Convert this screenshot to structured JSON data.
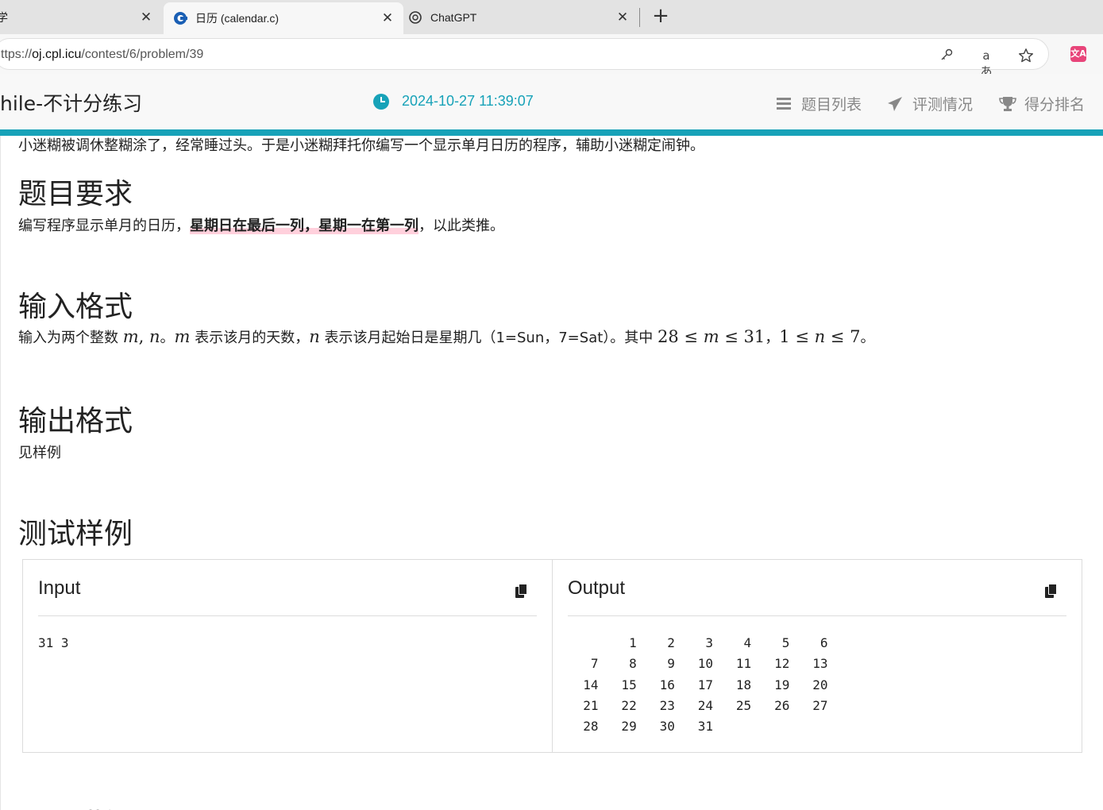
{
  "browser": {
    "tabs": [
      {
        "title": "学",
        "active": false
      },
      {
        "title": "日历 (calendar.c)",
        "active": true
      },
      {
        "title": "ChatGPT",
        "active": false
      }
    ],
    "close_glyph": "✕",
    "new_tab_glyph": "+",
    "url_prefix": "ttps://",
    "url_host": "oj.cpl.icu",
    "url_path": "/contest/6/problem/39",
    "icons": [
      "key-icon",
      "read-aloud-icon",
      "favorite-star-icon",
      "translate-extension-icon"
    ]
  },
  "navbar": {
    "brand": "hile-不计分练习",
    "clock": "2024-10-27 11:39:07",
    "items": [
      "题目列表",
      "评测情况",
      "得分排名"
    ],
    "accent": "#17a2b8"
  },
  "problem": {
    "intro": "小迷糊被调休整糊涂了，经常睡过头。于是小迷糊拜托你编写一个显示单月日历的程序，辅助小迷糊定闹钟。",
    "req_title": "题目要求",
    "req_pre": "编写程序显示单月的日历，",
    "req_bold": "星期日在最后一列，星期一在第一列",
    "req_post": "，以此类推。",
    "input_title": "输入格式",
    "input_p1": "输入为两个整数 ",
    "input_m": "m",
    "input_comma": ", ",
    "input_n": "n",
    "input_p2": "。",
    "input_p3": " 表示该月的天数，",
    "input_p4": " 表示该月起始日是星期几（1=Sun，7=Sat）。其中 ",
    "input_r1": "28 ≤ ",
    "input_r2": " ≤ 31",
    "input_sep": "，",
    "input_r3": "1 ≤ ",
    "input_r4": " ≤ 7",
    "input_end": "。",
    "output_title": "输出格式",
    "output_text": "见样例",
    "sample_title": "测试样例",
    "next_title_peek": "题目讲解"
  },
  "sample": {
    "input_label": "Input",
    "output_label": "Output",
    "input_text": "31 3",
    "output_text": "        1    2    3    4    5    6\n   7    8    9   10   11   12   13\n  14   15   16   17   18   19   20\n  21   22   23   24   25   26   27\n  28   29   30   31"
  }
}
